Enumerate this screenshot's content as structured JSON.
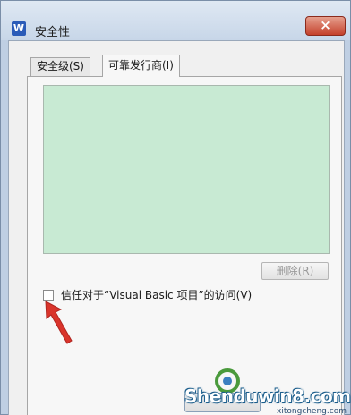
{
  "window": {
    "app_icon_letter": "W",
    "title": "安全性",
    "close_symbol": "×"
  },
  "tabs": [
    {
      "label": "安全级(S)"
    },
    {
      "label": "可靠发行商(I)",
      "selected": true
    }
  ],
  "publishers_list": {
    "items": []
  },
  "delete_button": {
    "label": "删除(R)",
    "enabled": false
  },
  "trust_vba_checkbox": {
    "label": "信任对于“Visual Basic 项目”的访问(V)",
    "checked": false
  },
  "watermark": {
    "text": "Shenduwin8.com",
    "sub_text": "xitongcheng.com"
  },
  "colors": {
    "list_background": "#c8ead3",
    "annotation_arrow": "#d9342b",
    "close_button": "#c4402b"
  },
  "icons": {
    "app": "wps-writer-icon",
    "close": "close-icon",
    "annotation": "red-arrow-icon"
  }
}
